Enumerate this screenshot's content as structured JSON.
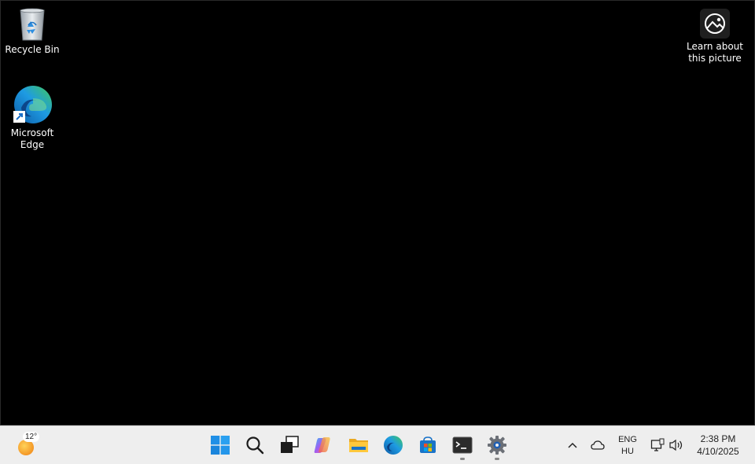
{
  "desktop": {
    "icons": [
      {
        "label": "Recycle Bin",
        "icon": "recycle-bin-icon"
      },
      {
        "label": "Microsoft Edge",
        "icon": "edge-icon"
      },
      {
        "label": "Learn about this picture",
        "icon": "learn-about-picture-icon"
      }
    ]
  },
  "taskbar": {
    "weather": {
      "temp": "12°",
      "icon": "sunny-weather-icon"
    },
    "pinned": [
      {
        "name": "Start",
        "icon": "windows-start-icon"
      },
      {
        "name": "Search",
        "icon": "search-icon"
      },
      {
        "name": "Task View",
        "icon": "task-view-icon"
      },
      {
        "name": "Copilot",
        "icon": "copilot-icon"
      },
      {
        "name": "File Explorer",
        "icon": "file-explorer-icon"
      },
      {
        "name": "Microsoft Edge",
        "icon": "edge-icon"
      },
      {
        "name": "Microsoft Store",
        "icon": "store-icon"
      },
      {
        "name": "Terminal",
        "icon": "terminal-icon"
      },
      {
        "name": "Settings",
        "icon": "settings-gear-icon"
      }
    ],
    "tray": {
      "language_top": "ENG",
      "language_bottom": "HU",
      "time": "2:38 PM",
      "date": "4/10/2025"
    }
  },
  "colors": {
    "desktop_bg": "#000000",
    "taskbar_bg": "#eeeeee",
    "windows_blue": "#1f8fe6",
    "edge_green": "#41c95a"
  }
}
